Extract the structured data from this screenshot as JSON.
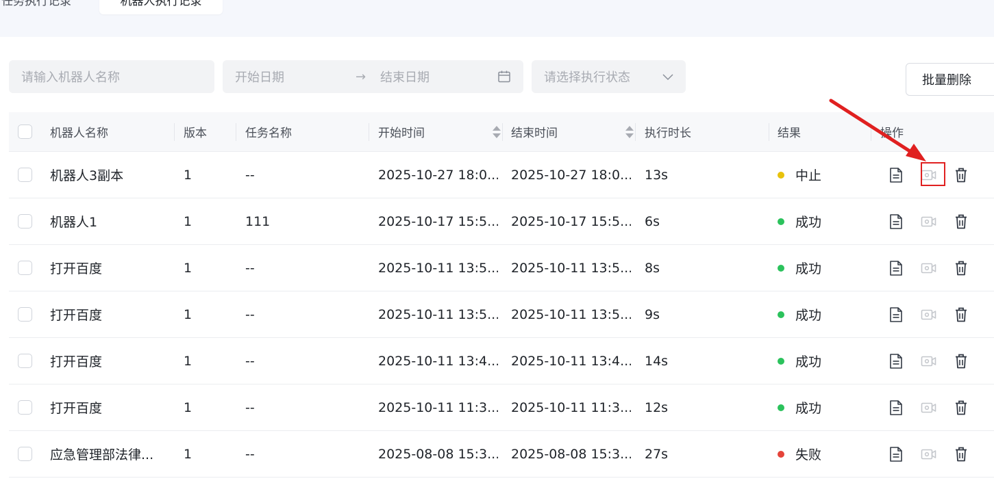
{
  "tabs": [
    {
      "label": "任务执行记录",
      "active": false
    },
    {
      "label": "机器人执行记录",
      "active": true
    }
  ],
  "filters": {
    "robot_name_placeholder": "请输入机器人名称",
    "start_date_placeholder": "开始日期",
    "range_separator": "→",
    "end_date_placeholder": "结束日期",
    "status_placeholder": "请选择执行状态"
  },
  "toolbar": {
    "batch_delete_label": "批量删除"
  },
  "table": {
    "columns": [
      "机器人名称",
      "版本",
      "任务名称",
      "开始时间",
      "结束时间",
      "执行时长",
      "结果",
      "操作"
    ],
    "rows": [
      {
        "name": "机器人3副本",
        "version": "1",
        "task": "--",
        "start": "2025-10-27 18:0...",
        "end": "2025-10-27 18:0...",
        "duration": "13s",
        "result": "中止",
        "status_color": "#e8c20c"
      },
      {
        "name": "机器人1",
        "version": "1",
        "task": "111",
        "start": "2025-10-17 15:5...",
        "end": "2025-10-17 15:5...",
        "duration": "6s",
        "result": "成功",
        "status_color": "#2bc25c"
      },
      {
        "name": "打开百度",
        "version": "1",
        "task": "--",
        "start": "2025-10-11 13:5...",
        "end": "2025-10-11 13:5...",
        "duration": "8s",
        "result": "成功",
        "status_color": "#2bc25c"
      },
      {
        "name": "打开百度",
        "version": "1",
        "task": "--",
        "start": "2025-10-11 13:5...",
        "end": "2025-10-11 13:5...",
        "duration": "9s",
        "result": "成功",
        "status_color": "#2bc25c"
      },
      {
        "name": "打开百度",
        "version": "1",
        "task": "--",
        "start": "2025-10-11 13:4...",
        "end": "2025-10-11 13:4...",
        "duration": "14s",
        "result": "成功",
        "status_color": "#2bc25c"
      },
      {
        "name": "打开百度",
        "version": "1",
        "task": "--",
        "start": "2025-10-11 11:3...",
        "end": "2025-10-11 11:3...",
        "duration": "12s",
        "result": "成功",
        "status_color": "#2bc25c"
      },
      {
        "name": "应急管理部法律...",
        "version": "1",
        "task": "--",
        "start": "2025-08-08 15:3...",
        "end": "2025-08-08 15:3...",
        "duration": "27s",
        "result": "失败",
        "status_color": "#e5443a"
      }
    ]
  },
  "row_actions": [
    "document-icon",
    "video-icon",
    "trash-icon"
  ],
  "colors": {
    "annotation": "#e02020",
    "success": "#2bc25c",
    "aborted": "#e8c20c",
    "failed": "#e5443a"
  }
}
